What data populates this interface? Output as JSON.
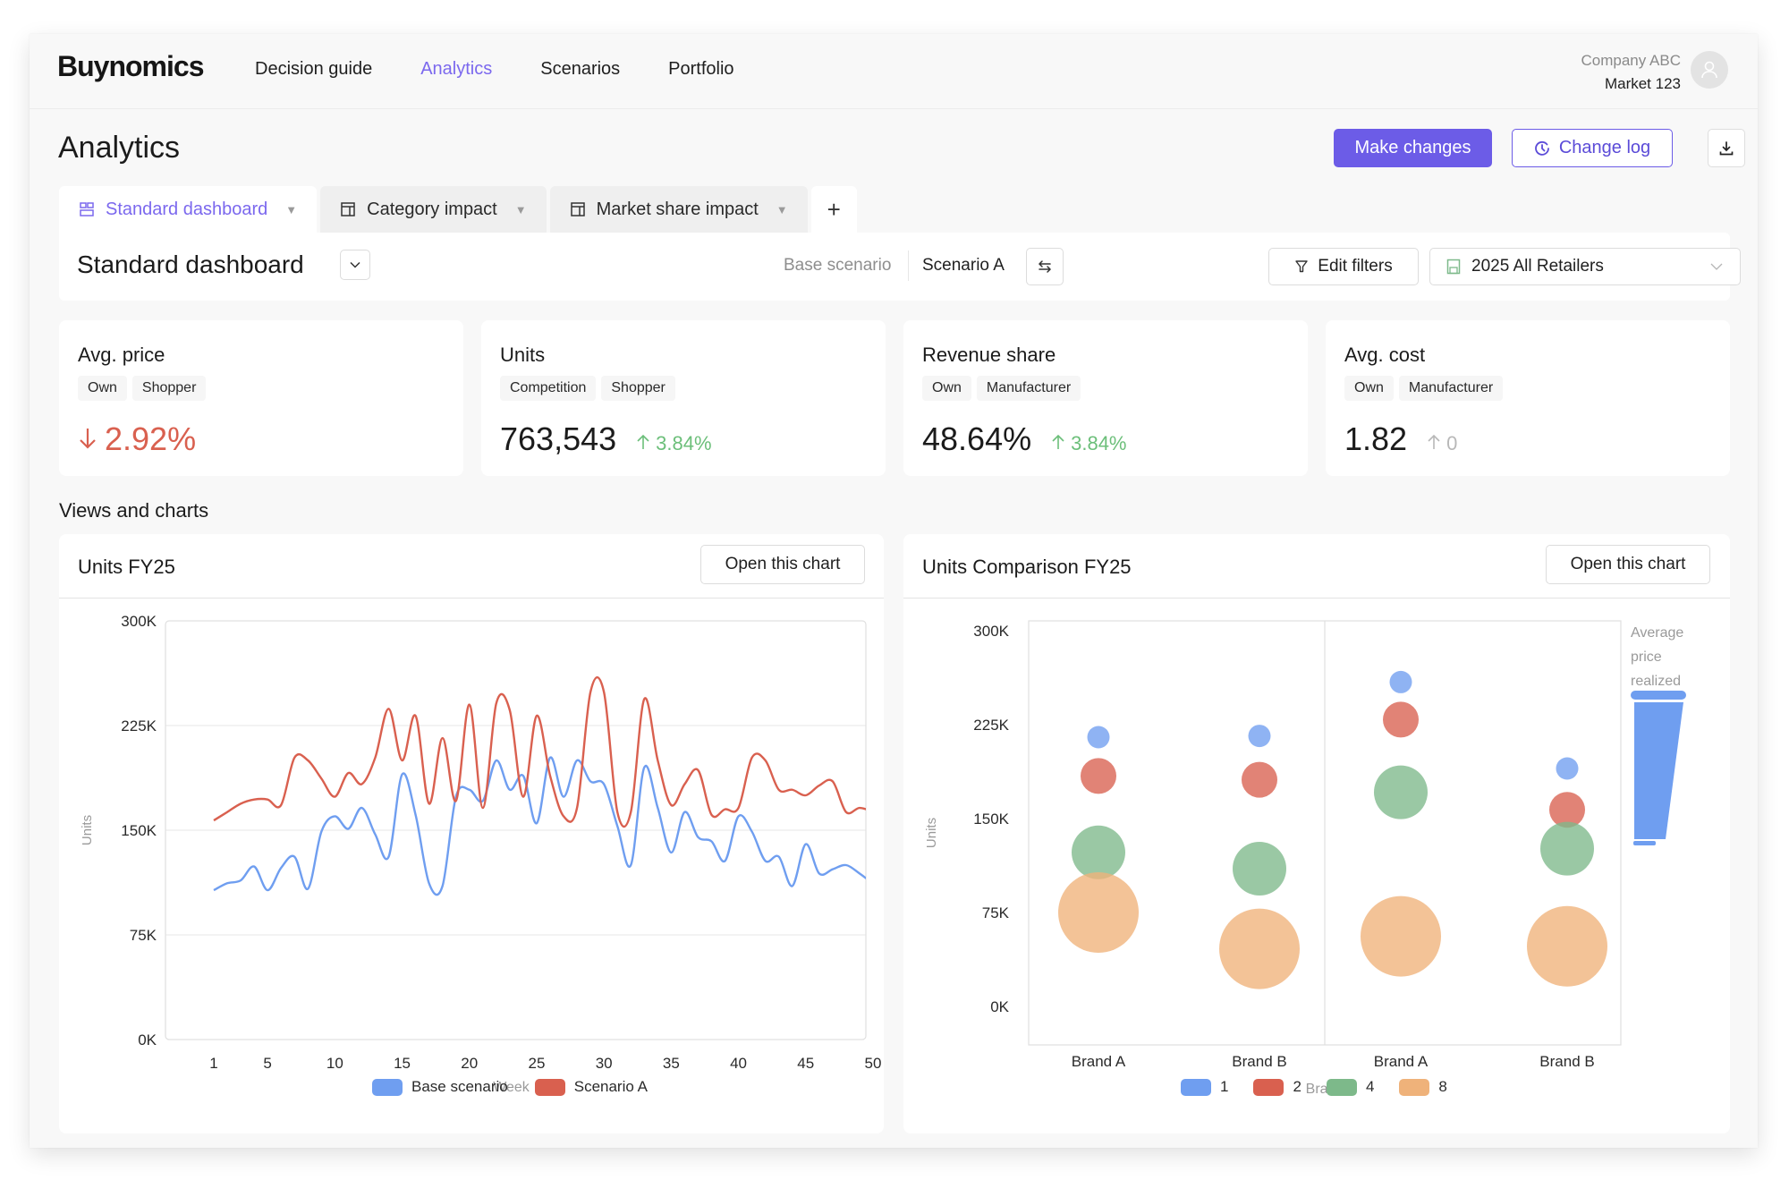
{
  "app": {
    "logo": "Buynomics",
    "nav": [
      {
        "label": "Decision guide",
        "active": false
      },
      {
        "label": "Analytics",
        "active": true
      },
      {
        "label": "Scenarios",
        "active": false
      },
      {
        "label": "Portfolio",
        "active": false
      }
    ],
    "account": {
      "company": "Company ABC",
      "market": "Market 123",
      "avatar_icon": "user-icon"
    }
  },
  "page": {
    "title": "Analytics",
    "actions": {
      "make_changes": "Make changes",
      "change_log": "Change log",
      "change_log_icon": "history-icon",
      "download_icon": "download-icon"
    }
  },
  "tabs": [
    {
      "label": "Standard dashboard",
      "icon": "dashboard-icon",
      "active": true
    },
    {
      "label": "Category impact",
      "icon": "layout-icon",
      "active": false
    },
    {
      "label": "Market share impact",
      "icon": "layout-icon",
      "active": false
    }
  ],
  "add_tab_label": "+",
  "dashboard": {
    "title": "Standard dashboard",
    "base_scenario_label": "Base scenario",
    "scenario": "Scenario A",
    "edit_filters": "Edit filters",
    "retailer_select": "2025 All Retailers"
  },
  "kpis": [
    {
      "title": "Avg. price",
      "chips": [
        "Own",
        "Shopper"
      ],
      "value": "",
      "delta": "2.92%",
      "direction": "down",
      "tone": "negative"
    },
    {
      "title": "Units",
      "chips": [
        "Competition",
        "Shopper"
      ],
      "value": "763,543",
      "delta": "3.84%",
      "direction": "up",
      "tone": "positive"
    },
    {
      "title": "Revenue share",
      "chips": [
        "Own",
        "Manufacturer"
      ],
      "value": "48.64%",
      "delta": "3.84%",
      "direction": "up",
      "tone": "positive"
    },
    {
      "title": "Avg. cost",
      "chips": [
        "Own",
        "Manufacturer"
      ],
      "value": "1.82",
      "delta": "0",
      "direction": "up",
      "tone": "neutral"
    }
  ],
  "section_title": "Views and charts",
  "open_chart_label": "Open this chart",
  "colors": {
    "accent": "#6c5ce7",
    "series_blue": "#6f9ef0",
    "series_red": "#d9604f",
    "series_green": "#7db98a",
    "series_orange": "#efb27a",
    "positive": "#6cbf7a",
    "negative": "#d9604f"
  },
  "chart_data": [
    {
      "type": "line",
      "title": "Units FY25",
      "xlabel": "Week",
      "ylabel": "Units",
      "ylim": [
        0,
        300000
      ],
      "yticks": [
        "0K",
        "75K",
        "150K",
        "225K",
        "300K"
      ],
      "xticks": [
        "1",
        "5",
        "10",
        "15",
        "20",
        "25",
        "30",
        "35",
        "40",
        "45",
        "50"
      ],
      "grid": true,
      "legend": "bottom",
      "x": [
        1,
        2,
        3,
        4,
        5,
        6,
        7,
        8,
        9,
        10,
        11,
        12,
        13,
        14,
        15,
        16,
        17,
        18,
        19,
        20,
        21,
        22,
        23,
        24,
        25,
        26,
        27,
        28,
        29,
        30,
        31,
        32,
        33,
        34,
        35,
        36,
        37,
        38,
        39,
        40,
        41,
        42,
        43,
        44,
        45,
        46,
        47,
        48,
        49,
        50,
        51,
        52
      ],
      "series": [
        {
          "name": "Base scenario",
          "color": "#6f9ef0",
          "values": [
            107000,
            112000,
            114000,
            124000,
            107000,
            123000,
            131000,
            108000,
            149000,
            160000,
            151000,
            166000,
            147000,
            131000,
            190000,
            161000,
            112000,
            110000,
            174000,
            179000,
            171000,
            200000,
            179000,
            189000,
            155000,
            202000,
            174000,
            200000,
            185000,
            183000,
            153000,
            125000,
            195000,
            166000,
            134000,
            163000,
            145000,
            142000,
            128000,
            160000,
            149000,
            128000,
            131000,
            110000,
            140000,
            119000,
            122000,
            125000,
            119000,
            112000,
            107000,
            106000
          ]
        },
        {
          "name": "Scenario A",
          "color": "#d9604f",
          "values": [
            157000,
            163000,
            169000,
            172000,
            172000,
            168000,
            202000,
            200000,
            187000,
            174000,
            191000,
            183000,
            202000,
            237000,
            200000,
            232000,
            169000,
            216000,
            171000,
            240000,
            166000,
            241000,
            236000,
            174000,
            232000,
            189000,
            160000,
            166000,
            249000,
            249000,
            163000,
            163000,
            244000,
            200000,
            168000,
            183000,
            193000,
            161000,
            165000,
            166000,
            202000,
            200000,
            179000,
            179000,
            175000,
            182000,
            185000,
            163000,
            166000,
            163000,
            158000,
            155000
          ]
        }
      ]
    },
    {
      "type": "scatter",
      "title": "Units Comparison FY25",
      "xlabel": "Brand",
      "ylabel": "Units",
      "ylim": [
        0,
        300000
      ],
      "yticks": [
        "0K",
        "75K",
        "150K",
        "225K",
        "300K"
      ],
      "categories": [
        "Brand A",
        "Brand B",
        "Brand A",
        "Brand B"
      ],
      "panels": 2,
      "size_legend_title": "Average price realized",
      "legend": "bottom",
      "series": [
        {
          "name": "1",
          "color": "#6f9ef0",
          "values": [
            215000,
            216000,
            259000,
            190000
          ],
          "size": 1
        },
        {
          "name": "2",
          "color": "#d9604f",
          "values": [
            184000,
            181000,
            229000,
            157000
          ],
          "size": 2
        },
        {
          "name": "4",
          "color": "#7db98a",
          "values": [
            123000,
            110000,
            171000,
            126000
          ],
          "size": 4
        },
        {
          "name": "8",
          "color": "#efb27a",
          "values": [
            75000,
            46000,
            56000,
            48000
          ],
          "size": 8
        }
      ]
    }
  ]
}
